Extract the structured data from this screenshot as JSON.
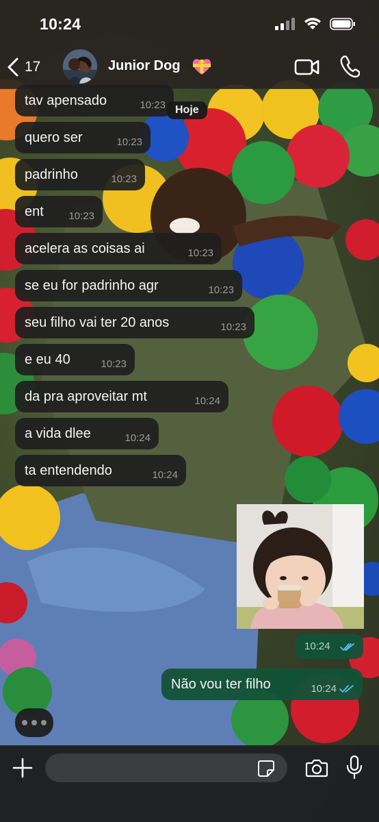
{
  "status_bar": {
    "time": "10:24"
  },
  "header": {
    "back_count": "17",
    "contact_name": "Junior Dog",
    "contact_emoji": "heart-with-ribbon-icon"
  },
  "date_pill": "Hoje",
  "messages": [
    {
      "text": "tav apensado",
      "time": "10:23"
    },
    {
      "text": "quero ser",
      "time": "10:23"
    },
    {
      "text": "padrinho",
      "time": "10:23"
    },
    {
      "text": "ent",
      "time": "10:23"
    },
    {
      "text": "acelera as coisas ai",
      "time": "10:23"
    },
    {
      "text": "se eu for padrinho agr",
      "time": "10:23"
    },
    {
      "text": "seu filho vai ter 20 anos",
      "time": "10:23"
    },
    {
      "text": "e eu 40",
      "time": "10:23"
    },
    {
      "text": "da pra aproveitar mt",
      "time": "10:24"
    },
    {
      "text": "a vida dlee",
      "time": "10:24"
    },
    {
      "text": "ta entendendo",
      "time": "10:24"
    }
  ],
  "outgoing": {
    "sticker_time": "10:24",
    "text": "Não vou ter filho",
    "time": "10:24"
  },
  "composer": {
    "placeholder": ""
  },
  "colors": {
    "incoming_bubble": "#1f1f1f",
    "outgoing_bubble": "#125238",
    "read_ticks": "#53bdeb"
  }
}
